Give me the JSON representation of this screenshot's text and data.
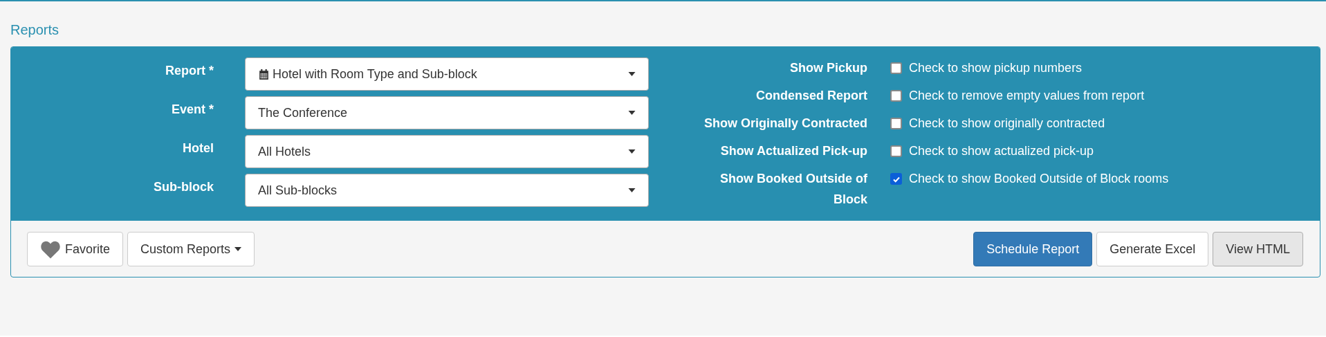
{
  "title": "Reports",
  "selects": [
    {
      "label": "Report *",
      "value": "Hotel with Room Type and Sub-block",
      "icon": true
    },
    {
      "label": "Event *",
      "value": "The Conference",
      "icon": false
    },
    {
      "label": "Hotel",
      "value": "All Hotels",
      "icon": false
    },
    {
      "label": "Sub-block",
      "value": "All Sub-blocks",
      "icon": false
    }
  ],
  "options": [
    {
      "label": "Show Pickup",
      "text": "Check to show pickup numbers",
      "checked": false
    },
    {
      "label": "Condensed Report",
      "text": "Check to remove empty values from report",
      "checked": false
    },
    {
      "label": "Show Originally Contracted",
      "text": "Check to show originally contracted",
      "checked": false
    },
    {
      "label": "Show Actualized Pick-up",
      "text": "Check to show actualized pick-up",
      "checked": false
    },
    {
      "label": "Show Booked Outside of Block",
      "text": "Check to show Booked Outside of Block rooms",
      "checked": true
    }
  ],
  "left_buttons": [
    {
      "label": "Favorite",
      "kind": "favorite"
    },
    {
      "label": "Custom Reports",
      "kind": "dropdown"
    }
  ],
  "right_buttons": [
    {
      "label": "Schedule Report",
      "kind": "primary"
    },
    {
      "label": "Generate Excel",
      "kind": "default"
    },
    {
      "label": "View HTML",
      "kind": "active"
    }
  ]
}
